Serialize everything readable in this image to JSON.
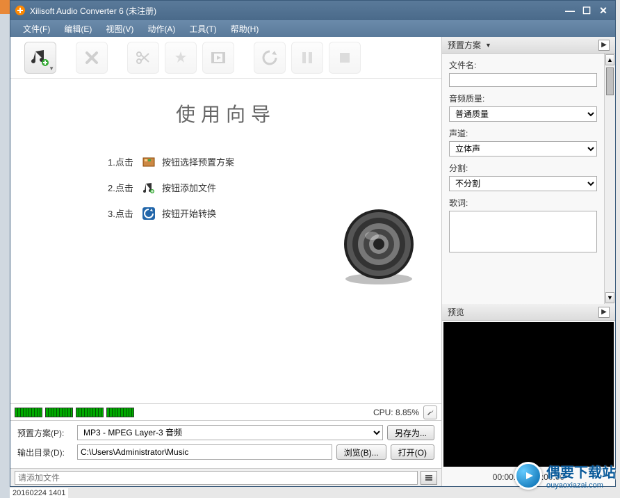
{
  "titlebar": {
    "title": "Xilisoft Audio Converter 6 (未注册)"
  },
  "menu": {
    "file": "文件(F)",
    "edit": "编辑(E)",
    "view": "视图(V)",
    "action": "动作(A)",
    "tools": "工具(T)",
    "help": "帮助(H)"
  },
  "wizard": {
    "title": "使用向导",
    "step1_num": "1.点击",
    "step1_text": "按钮选择预置方案",
    "step2_num": "2.点击",
    "step2_text": "按钮添加文件",
    "step3_num": "3.点击",
    "step3_text": "按钮开始转换"
  },
  "cpu": {
    "label": "CPU:",
    "value": "8.85%"
  },
  "bottom": {
    "preset_label": "预置方案(P):",
    "preset_value": "MP3 - MPEG Layer-3 音频",
    "saveas_btn": "另存为...",
    "output_label": "输出目录(D):",
    "output_value": "C:\\Users\\Administrator\\Music",
    "browse_btn": "浏览(B)...",
    "open_btn": "打开(O)"
  },
  "addbar": {
    "placeholder": "请添加文件"
  },
  "right": {
    "presets_header": "预置方案",
    "filename_label": "文件名:",
    "filename_value": "",
    "quality_label": "音频质量:",
    "quality_value": "普通质量",
    "channel_label": "声道:",
    "channel_value": "立体声",
    "split_label": "分割:",
    "split_value": "不分割",
    "lyrics_label": "歌词:",
    "lyrics_value": "",
    "preview_header": "预览",
    "preview_time": "00:00:00 / 00:00:00"
  },
  "watermark": {
    "text": "偶要下载站",
    "sub": "ouyaoxiazai.com"
  },
  "timestamp": "20160224 1401"
}
